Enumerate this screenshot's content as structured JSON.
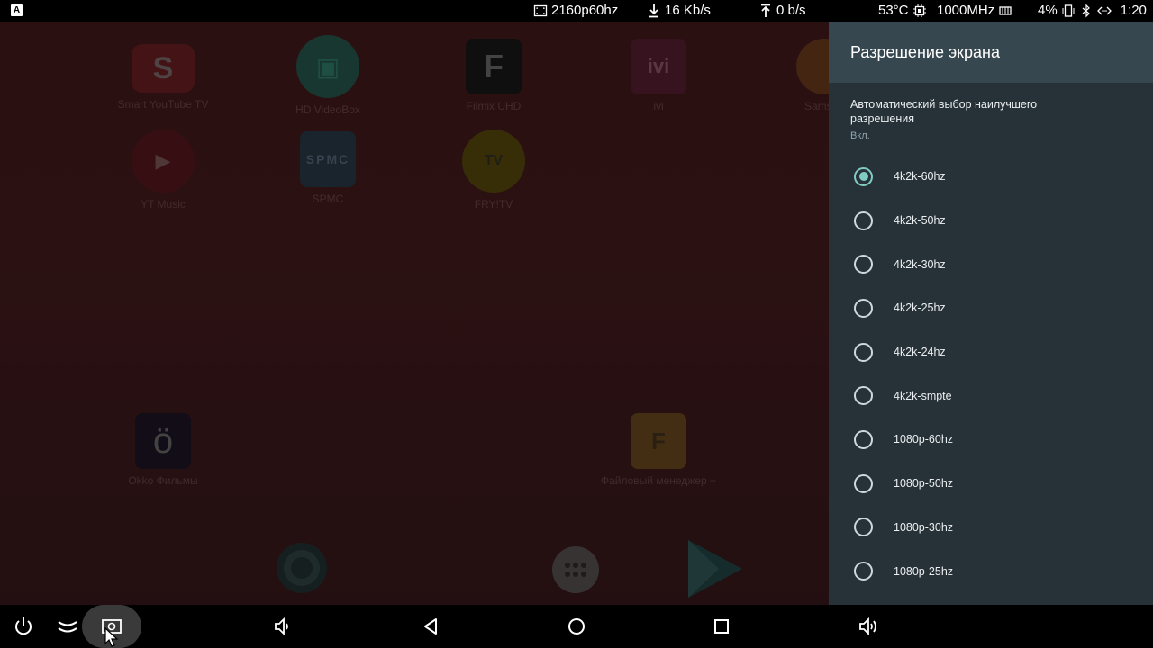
{
  "status_bar": {
    "left_icon": "A",
    "resolution": "2160p60hz",
    "download": "16 Kb/s",
    "upload": "0 b/s",
    "temperature": "53°C",
    "cpu_freq": "1000MHz",
    "battery": "4%",
    "time": "1:20"
  },
  "apps": [
    {
      "label": "Smart YouTube TV",
      "icon": "smart-youtube-icon",
      "glyph": "S",
      "color": "#5a1a1e"
    },
    {
      "label": "HD VideoBox",
      "icon": "hd-videobox-icon",
      "glyph": "▣",
      "color": "#1e5a4a"
    },
    {
      "label": "Filmix UHD",
      "icon": "filmix-icon",
      "glyph": "F",
      "color": "#1a1a1a"
    },
    {
      "label": "ivi",
      "icon": "ivi-icon",
      "glyph": "ivi",
      "color": "#4a1a2a"
    },
    {
      "label": "Samsun",
      "icon": "samsung-icon",
      "glyph": "",
      "color": "#6a3a1a"
    },
    {
      "label": "YT Music",
      "icon": "yt-music-icon",
      "glyph": "▶",
      "color": "#5a1a1e"
    },
    {
      "label": "SPMC",
      "icon": "spmc-icon",
      "glyph": "SPMC",
      "color": "#2a3a4a"
    },
    {
      "label": "FRY!TV",
      "icon": "frytv-icon",
      "glyph": "TV",
      "color": "#5a4a0a"
    },
    {
      "label": "Okko Фильмы",
      "icon": "okko-icon",
      "glyph": "ö",
      "color": "#1a1428"
    },
    {
      "label": "Файловый менеджер +",
      "icon": "file-manager-icon",
      "glyph": "F",
      "color": "#6a4a20"
    }
  ],
  "panel": {
    "title": "Разрешение экрана",
    "auto_title": "Автоматический выбор наилучшего разрешения",
    "auto_status": "Вкл.",
    "options": [
      {
        "label": "4k2k-60hz",
        "checked": true
      },
      {
        "label": "4k2k-50hz",
        "checked": false
      },
      {
        "label": "4k2k-30hz",
        "checked": false
      },
      {
        "label": "4k2k-25hz",
        "checked": false
      },
      {
        "label": "4k2k-24hz",
        "checked": false
      },
      {
        "label": "4k2k-smpte",
        "checked": false
      },
      {
        "label": "1080p-60hz",
        "checked": false
      },
      {
        "label": "1080p-50hz",
        "checked": false
      },
      {
        "label": "1080p-30hz",
        "checked": false
      },
      {
        "label": "1080p-25hz",
        "checked": false
      }
    ]
  },
  "nav_icons": [
    "power-icon",
    "collapse-icon",
    "screenshot-icon",
    "volume-down-icon",
    "back-icon",
    "home-icon",
    "recents-icon",
    "volume-up-icon"
  ],
  "colors": {
    "accent": "#80cbc4",
    "panel_bg": "#263238",
    "panel_header": "#37474f"
  }
}
